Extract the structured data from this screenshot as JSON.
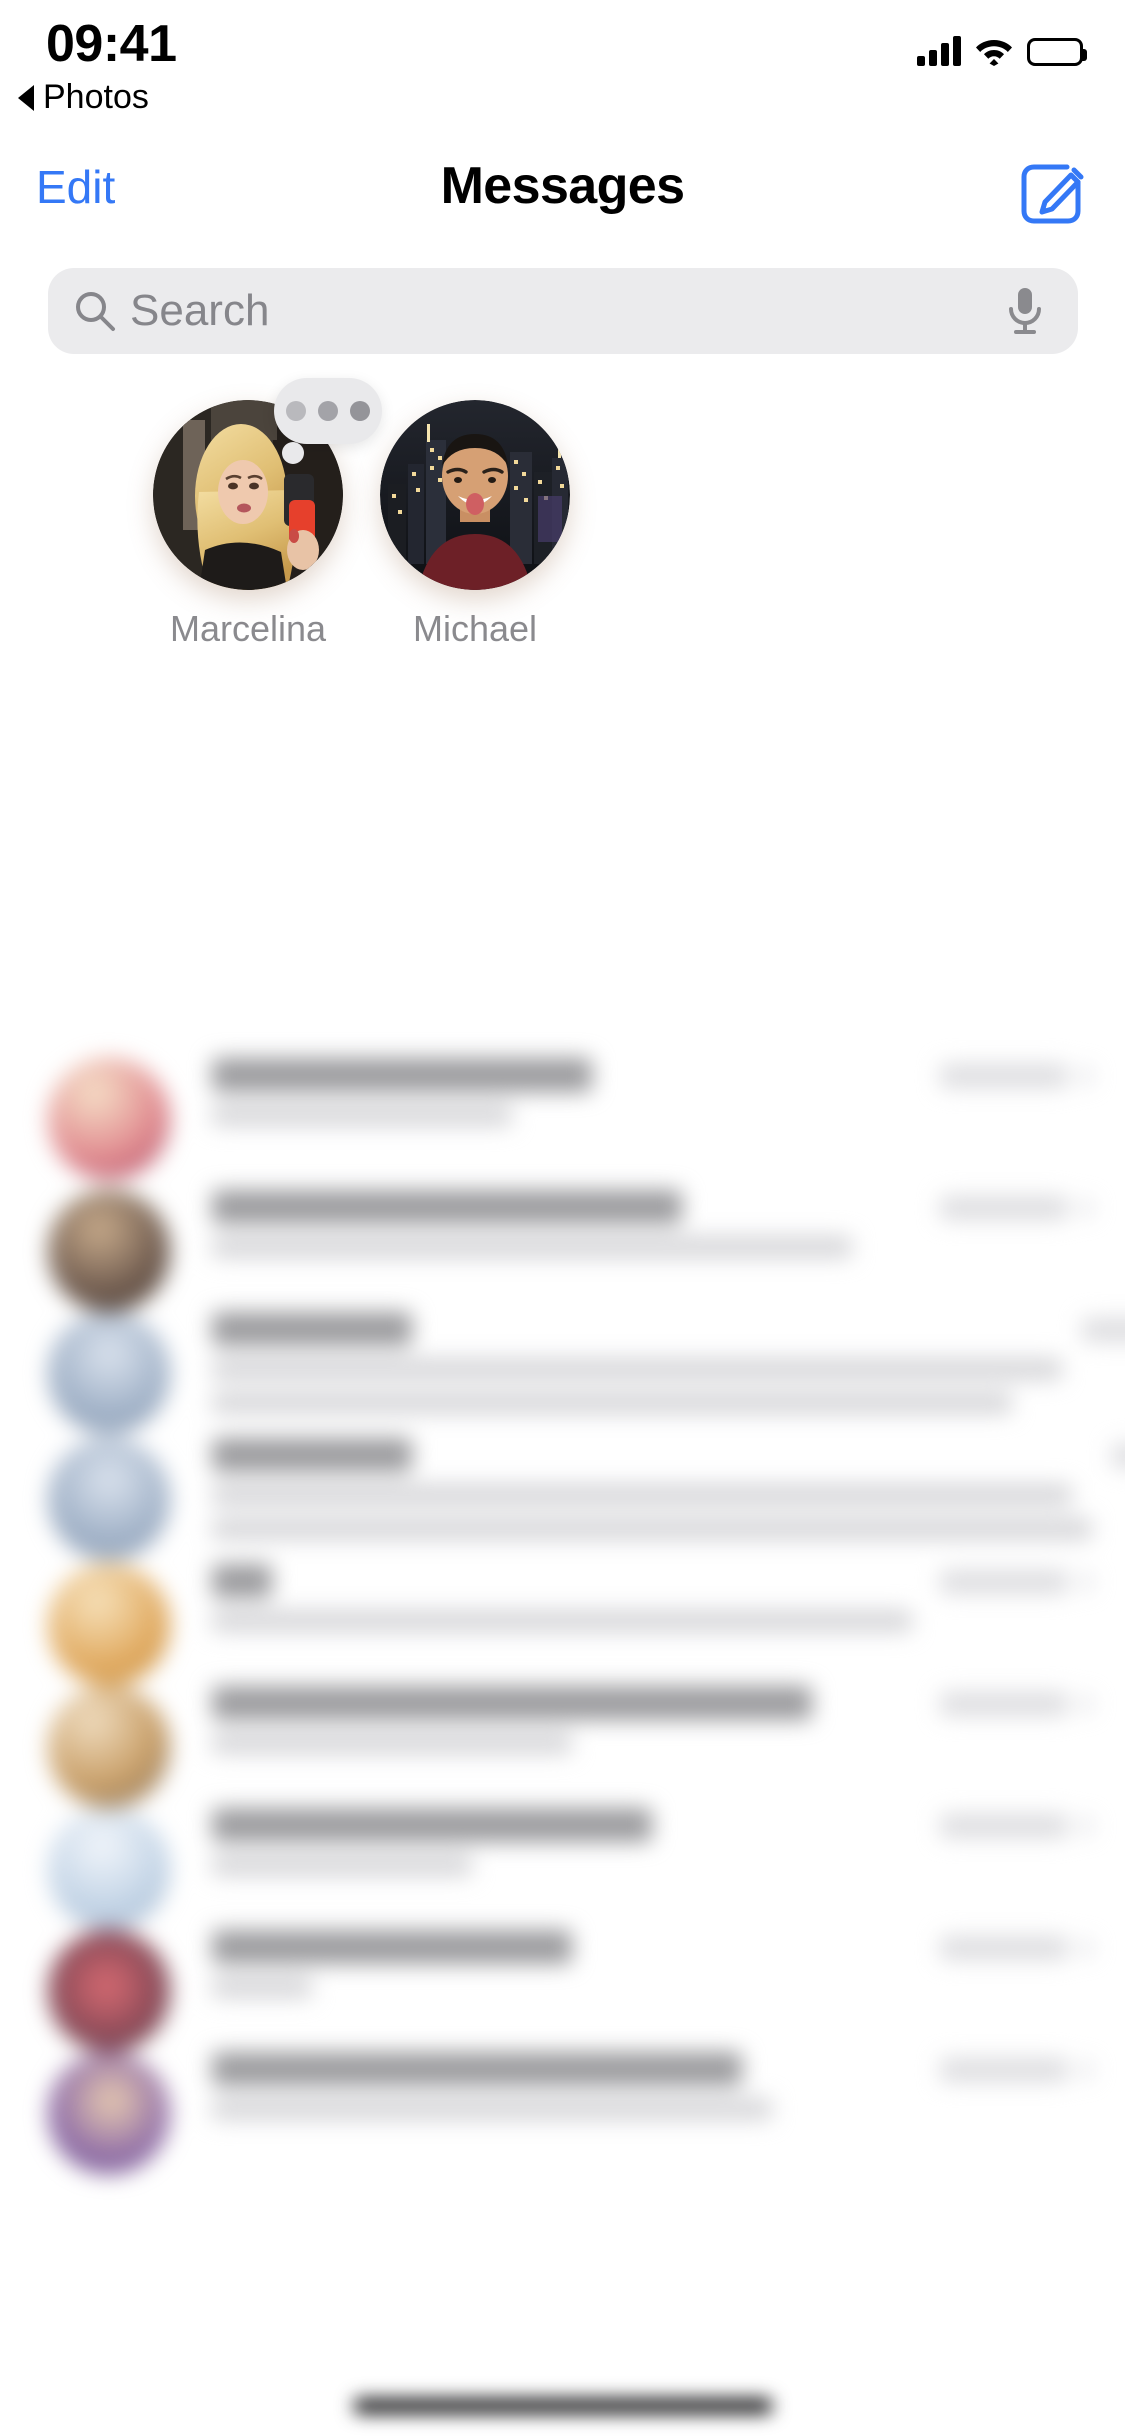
{
  "status_bar": {
    "time": "09:41",
    "back_label": "Photos",
    "icons": {
      "signal": "cellular-signal-icon",
      "wifi": "wifi-icon",
      "battery": "battery-icon"
    }
  },
  "nav_bar": {
    "edit_label": "Edit",
    "title": "Messages",
    "compose_icon": "compose-icon"
  },
  "search": {
    "placeholder": "Search",
    "value": "",
    "search_icon": "search-icon",
    "mic_icon": "microphone-icon"
  },
  "pinned": [
    {
      "name": "Marcelina",
      "typing": true,
      "typing_dots": 3,
      "avatar_desc": "blond-woman-mirror-selfie"
    },
    {
      "name": "Michael",
      "typing": false,
      "avatar_desc": "man-city-skyline-night"
    }
  ],
  "conversations": [
    {
      "name": "",
      "snippet": "",
      "time": "",
      "redacted": true,
      "lines": 1,
      "avatar_color": "#e4a48f",
      "name_w": 380,
      "snip_w": 300
    },
    {
      "name": "",
      "snippet": "",
      "time": "",
      "redacted": true,
      "lines": 1,
      "avatar_color": "#6e5a4e",
      "name_w": 470,
      "snip_w": 640
    },
    {
      "name": "",
      "snippet": "",
      "time": "",
      "redacted": true,
      "lines": 2,
      "avatar_color": "#b8c4d4",
      "name_w": 200,
      "snip_w": 850
    },
    {
      "name": "",
      "snippet": "",
      "time": "",
      "redacted": true,
      "lines": 2,
      "avatar_color": "#b8c4d4",
      "name_w": 200,
      "snip_w": 860
    },
    {
      "name": "",
      "snippet": "",
      "time": "",
      "redacted": true,
      "lines": 1,
      "avatar_color": "#e0a95f",
      "name_w": 60,
      "snip_w": 700
    },
    {
      "name": "",
      "snippet": "",
      "time": "",
      "redacted": true,
      "lines": 1,
      "avatar_color": "#c9a06a",
      "name_w": 600,
      "snip_w": 360
    },
    {
      "name": "",
      "snippet": "",
      "time": "",
      "redacted": true,
      "lines": 1,
      "avatar_color": "#c3d4e6",
      "name_w": 440,
      "snip_w": 260
    },
    {
      "name": "",
      "snippet": "",
      "time": "",
      "redacted": true,
      "lines": 1,
      "avatar_color": "#8a4a58",
      "name_w": 360,
      "snip_w": 100
    },
    {
      "name": "",
      "snippet": "",
      "time": "",
      "redacted": true,
      "lines": 1,
      "avatar_color": "#8e6ca8",
      "name_w": 530,
      "snip_w": 560
    }
  ],
  "home_indicator": {
    "present": true
  },
  "colors": {
    "accent_blue": "#3478f6",
    "search_bg": "#ebebed",
    "secondary_text": "#8a8a8e",
    "bubble_bg": "#e9e9eb",
    "page_bg": "#ffffff"
  }
}
